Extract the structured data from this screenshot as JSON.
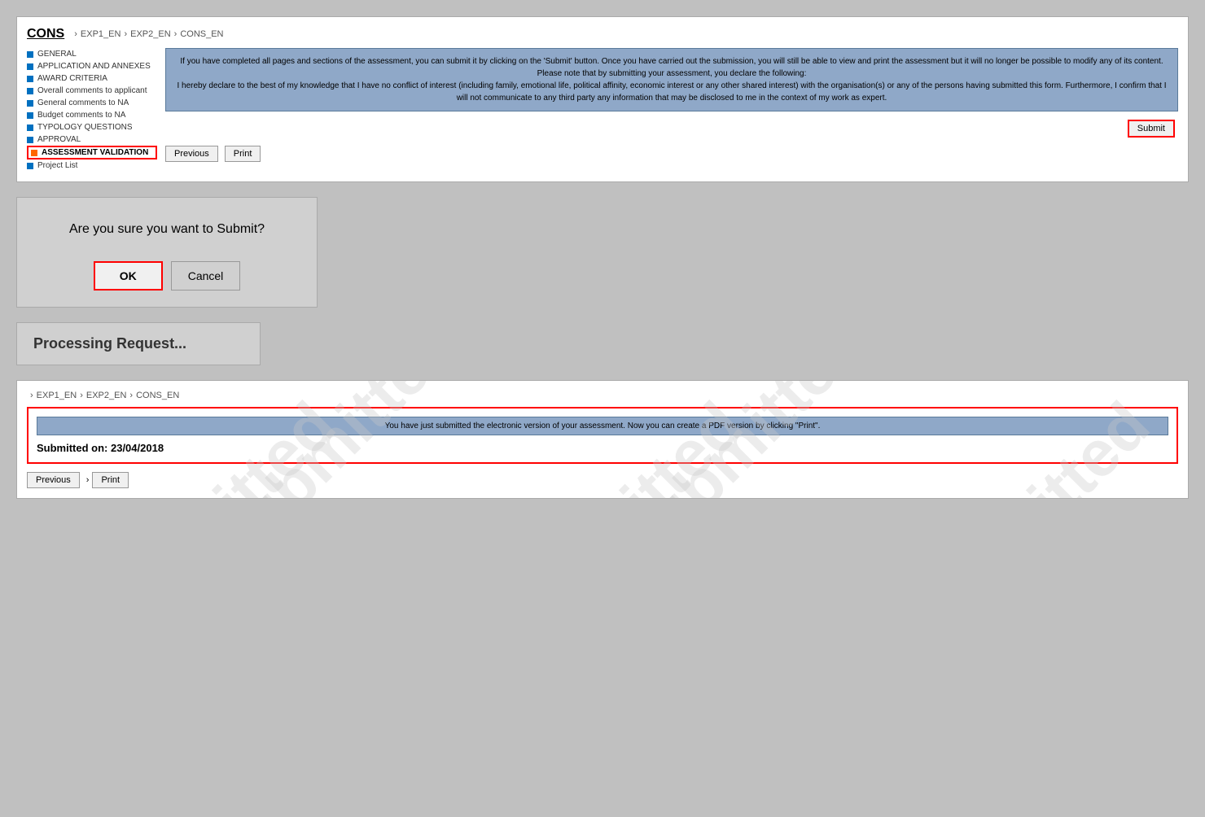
{
  "app": {
    "title": "CONS"
  },
  "breadcrumb": {
    "logo": "CONS",
    "items": [
      "EXP1_EN",
      "EXP2_EN",
      "CONS_EN"
    ]
  },
  "sidebar": {
    "items": [
      {
        "label": "GENERAL",
        "color": "blue",
        "active": false
      },
      {
        "label": "APPLICATION AND ANNEXES",
        "color": "blue",
        "active": false
      },
      {
        "label": "AWARD CRITERIA",
        "color": "blue",
        "active": false
      },
      {
        "label": "Overall comments to applicant",
        "color": "blue",
        "active": false
      },
      {
        "label": "General comments to NA",
        "color": "blue",
        "active": false
      },
      {
        "label": "Budget comments to NA",
        "color": "blue",
        "active": false
      },
      {
        "label": "TYPOLOGY QUESTIONS",
        "color": "blue",
        "active": false
      },
      {
        "label": "APPROVAL",
        "color": "blue",
        "active": false
      },
      {
        "label": "ASSESSMENT VALIDATION",
        "color": "orange",
        "active": true
      },
      {
        "label": "Project List",
        "color": "blue",
        "active": false
      }
    ]
  },
  "info_box": {
    "text": "If you have completed all pages and sections of the assessment, you can submit it by clicking on the 'Submit' button. Once you have carried out the submission, you will still be able to view and print the assessment but it will no longer be possible to modify any of its content.\nPlease note that by submitting your assessment, you declare the following:\nI hereby declare to the best of my knowledge that I have no conflict of interest (including family, emotional life, political affinity, economic interest or any other shared interest) with the organisation(s) or any of the persons having submitted this form. Furthermore, I confirm that I will not communicate to any third party any information that may be disclosed to me in the context of my work as expert."
  },
  "buttons": {
    "submit": "Submit",
    "previous": "Previous",
    "print": "Print",
    "ok": "OK",
    "cancel": "Cancel"
  },
  "dialog": {
    "title": "Are you sure you want to Submit?"
  },
  "processing": {
    "text": "Processing Request..."
  },
  "submitted": {
    "message": "You have just submitted the electronic version of your assessment. Now you can create a PDF version by clicking \"Print\".",
    "submitted_on_label": "Submitted on: 23/04/2018",
    "watermark": "submitted"
  }
}
